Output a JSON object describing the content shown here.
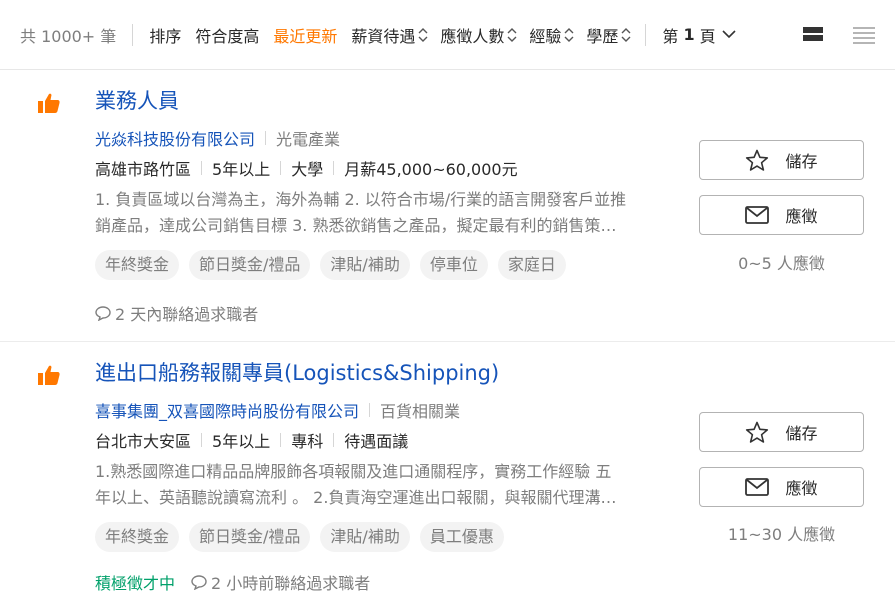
{
  "toolbar": {
    "count": "共 1000+ 筆",
    "sort_label": "排序",
    "sort_relevance": "符合度高",
    "sort_recent": "最近更新",
    "sort_salary": "薪資待遇",
    "sort_applicants": "應徵人數",
    "sort_experience": "經驗",
    "sort_education": "學歷",
    "page_prefix": "第",
    "page_number": "1",
    "page_suffix": "頁",
    "accent_color": "#ff7800"
  },
  "jobs": [
    {
      "title": "業務人員",
      "company": "光焱科技股份有限公司",
      "industry": "光電產業",
      "location": "高雄市路竹區",
      "experience": "5年以上",
      "education": "大學",
      "salary": "月薪45,000~60,000元",
      "desc_line1": "1. 負責區域以台灣為主，海外為輔 2. 以符合市場/行業的語言開發客戶並推",
      "desc_line2": "銷產品，達成公司銷售目標 3. 熟悉欲銷售之產品，擬定最有利的銷售策…",
      "tags": [
        "年終獎金",
        "節日獎金/禮品",
        "津貼/補助",
        "停車位",
        "家庭日"
      ],
      "contact": "2 天內聯絡過求職者",
      "save_label": "儲存",
      "apply_label": "應徵",
      "applicants": "0~5 人應徵"
    },
    {
      "title": "進出口船務報關專員(Logistics&Shipping)",
      "company": "喜事集團_双喜國際時尚股份有限公司",
      "industry": "百貨相關業",
      "location": "台北市大安區",
      "experience": "5年以上",
      "education": "專科",
      "salary": "待遇面議",
      "desc_line1": "1.熟悉國際進口精品品牌服飾各項報關及進口通關程序，實務工作經驗 五",
      "desc_line2": "年以上、英語聽說讀寫流利 。 2.負責海空運進出口報關，與報關代理溝…",
      "tags": [
        "年終獎金",
        "節日獎金/禮品",
        "津貼/補助",
        "員工優惠"
      ],
      "urgent": "積極徵才中",
      "contact": "2 小時前聯絡過求職者",
      "save_label": "儲存",
      "apply_label": "應徵",
      "applicants": "11~30 人應徵"
    }
  ]
}
